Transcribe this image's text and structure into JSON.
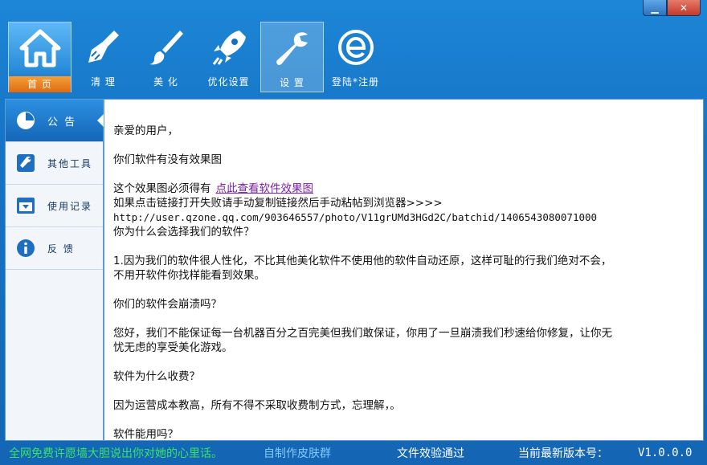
{
  "window_controls": {
    "minimize": "▁",
    "close": "✕"
  },
  "toolbar": [
    {
      "label": "首 页",
      "icon": "home-icon"
    },
    {
      "label": "清 理",
      "icon": "broom-icon"
    },
    {
      "label": "美 化",
      "icon": "brush-icon"
    },
    {
      "label": "优化设置",
      "icon": "rocket-icon"
    },
    {
      "label": "设 置",
      "icon": "wrench-icon"
    },
    {
      "label": "登陆*注册",
      "icon": "e-logo-icon"
    }
  ],
  "sidebar": [
    {
      "label": "公  告",
      "icon": "pie-chart-icon"
    },
    {
      "label": "其他工具",
      "icon": "tools-icon"
    },
    {
      "label": "使用记录",
      "icon": "download-box-icon"
    },
    {
      "label": "反  馈",
      "icon": "info-icon"
    }
  ],
  "content": {
    "greeting": "亲爱的用户，",
    "q0": "你们软件有没有效果图",
    "line1_prefix": "这个效果图必须得有",
    "link": "点此查看软件效果图",
    "line2": "如果点击链接打开失败请手动复制链接然后手动粘帖到浏览器>>>>",
    "url": "http://user.qzone.qq.com/903646557/photo/V11grUMd3HGd2C/batchid/1406543080071000",
    "q1": "你为什么会选择我们的软件？",
    "a1_l1": "1.因为我们的软件很人性化，不比其他美化软件不使用他的软件自动还原，这样可耻的行我们绝对不会，",
    "a1_l2": "不用开软件你找样能看到效果。",
    "q2": "你们的软件会崩溃吗？",
    "a2_l1": "您好，我们不能保证每一台机器百分之百完美但我们敢保证，你用了一旦崩溃我们秒速给你修复，让你无",
    "a2_l2": "忧无虑的享受美化游戏。",
    "q3": "软件为什么收费？",
    "a3": "因为运营成本教高，所有不得不采取收费制方式，忘理解，。",
    "q4": "软件能用吗？"
  },
  "status": {
    "marquee": "全网免费许愿墙大胆说出你对她的心里话。",
    "skin_group": "自制作皮肤群",
    "verify": "文件效验通过",
    "version_label": "当前最新版本号：",
    "version": "V1.0.0.0"
  }
}
